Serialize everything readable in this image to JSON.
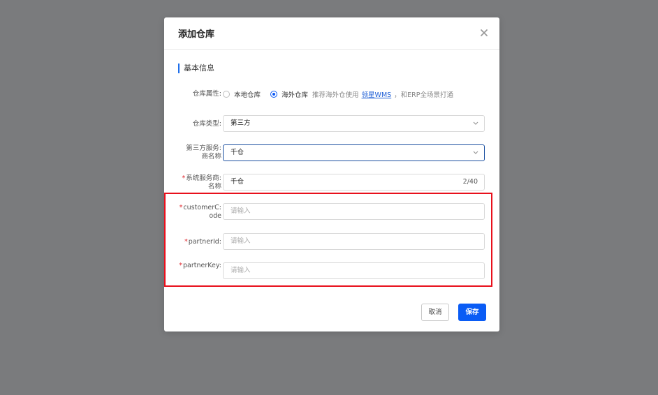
{
  "dialog": {
    "title": "添加仓库",
    "section_title": "基本信息"
  },
  "form": {
    "warehouse_attr": {
      "label": "仓库属性",
      "options": [
        {
          "label": "本地仓库",
          "checked": false
        },
        {
          "label": "海外仓库",
          "checked": true
        }
      ],
      "hint_prefix": "推荐海外仓使用",
      "hint_link": "领星WMS",
      "hint_suffix": "，和ERP全场景打通"
    },
    "warehouse_type": {
      "label": "仓库类型",
      "value": "第三方"
    },
    "provider_name": {
      "label_line1": "第三方服务",
      "label_line2": "商名称",
      "value": "千仓"
    },
    "system_provider": {
      "required": true,
      "label_line1": "系统服务商",
      "label_line2": "名称",
      "value": "千仓",
      "counter": "2/40"
    },
    "customer_code": {
      "required": true,
      "label_line1": "customerC",
      "label_line2": "ode",
      "placeholder": "请输入"
    },
    "partner_id": {
      "required": true,
      "label": "partnerId",
      "placeholder": "请输入"
    },
    "partner_key": {
      "required": true,
      "label": "partnerKey",
      "placeholder": "请输入"
    },
    "required_mark": "*",
    "colon": ":"
  },
  "footer": {
    "cancel_label": "取消",
    "save_label": "保存"
  },
  "colors": {
    "primary": "#0a5cf5",
    "highlight": "#e8101c",
    "required": "#e0282f"
  }
}
